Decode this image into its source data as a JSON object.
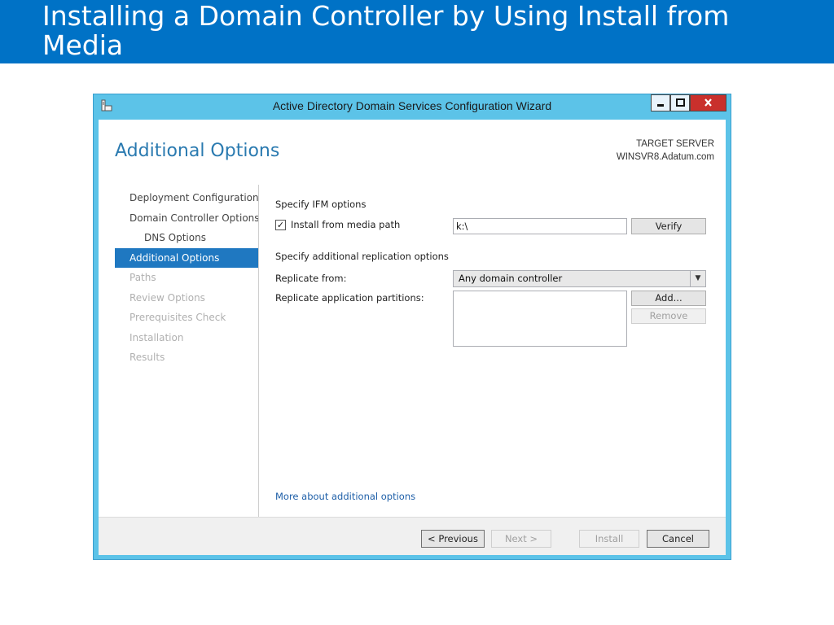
{
  "slide": {
    "title": "Installing a Domain Controller by Using Install from Media"
  },
  "window": {
    "title": "Active Directory Domain Services Configuration Wizard"
  },
  "page": {
    "heading": "Additional Options",
    "target_label": "TARGET SERVER",
    "target_value": "WINSVR8.Adatum.com"
  },
  "nav": {
    "items": [
      {
        "label": "Deployment Configuration",
        "state": "normal"
      },
      {
        "label": "Domain Controller Options",
        "state": "normal"
      },
      {
        "label": "DNS Options",
        "state": "normal"
      },
      {
        "label": "Additional Options",
        "state": "active"
      },
      {
        "label": "Paths",
        "state": "disabled"
      },
      {
        "label": "Review Options",
        "state": "disabled"
      },
      {
        "label": "Prerequisites Check",
        "state": "disabled"
      },
      {
        "label": "Installation",
        "state": "disabled"
      },
      {
        "label": "Results",
        "state": "disabled"
      }
    ]
  },
  "form": {
    "ifm_heading": "Specify IFM options",
    "install_from_media_label": "Install from media path",
    "install_from_media_checked": true,
    "media_path_value": "k:\\",
    "verify_label": "Verify",
    "replication_heading": "Specify additional replication options",
    "replicate_from_label": "Replicate from:",
    "replicate_from_value": "Any domain controller",
    "partitions_label": "Replicate application partitions:",
    "add_label": "Add...",
    "remove_label": "Remove",
    "more_link": "More about additional options"
  },
  "footer": {
    "previous_label": "< Previous",
    "next_label": "Next >",
    "install_label": "Install",
    "cancel_label": "Cancel"
  },
  "colors": {
    "slide_header": "#0072c6",
    "window_chrome": "#5cc3e8",
    "nav_active": "#1f78c1",
    "heading": "#2a7ab0",
    "close_button": "#c9302c"
  }
}
